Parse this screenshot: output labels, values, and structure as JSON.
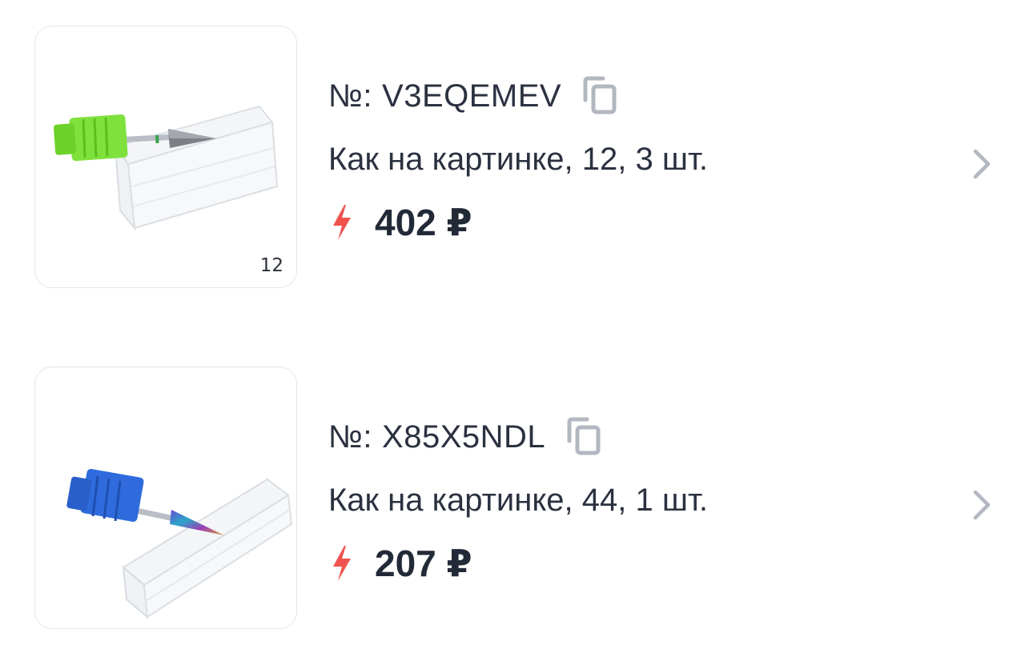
{
  "items": [
    {
      "sku_prefix": "№:",
      "sku": "V3EQEMEV",
      "variant": "Как на картинке, 12, 3 шт.",
      "price": "402 ₽",
      "thumb_caption": "12",
      "cap_color": "#7ee13c"
    },
    {
      "sku_prefix": "№:",
      "sku": "X85X5NDL",
      "variant": "Как на картинке, 44, 1 шт.",
      "price": "207 ₽",
      "thumb_caption": "",
      "cap_color": "#2f6bdc"
    }
  ],
  "icons": {
    "copy": "copy-icon",
    "bolt": "lightning-icon",
    "chevron": "chevron-right-icon"
  },
  "colors": {
    "bolt": "#f0524e",
    "icon_gray": "#b3b7c0",
    "border": "#e3e5ea"
  }
}
